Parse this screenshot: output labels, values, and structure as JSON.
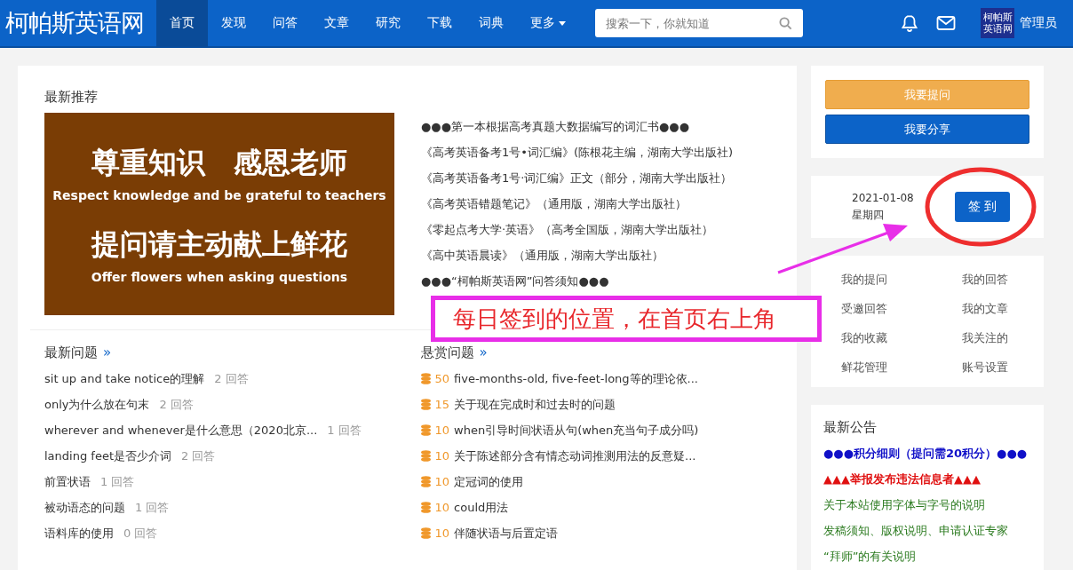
{
  "navbar": {
    "logo": "柯帕斯英语网",
    "items": [
      {
        "label": "首页",
        "selected": true
      },
      {
        "label": "发现",
        "selected": false
      },
      {
        "label": "问答",
        "selected": false
      },
      {
        "label": "文章",
        "selected": false
      },
      {
        "label": "研究",
        "selected": false
      },
      {
        "label": "下载",
        "selected": false
      },
      {
        "label": "词典",
        "selected": false
      },
      {
        "label": "更多",
        "selected": false,
        "dropdown": true
      }
    ],
    "search": {
      "placeholder": "搜索一下，你就知道"
    },
    "avatar_text": "柯帕斯英语网",
    "user": "管理员"
  },
  "recommend": {
    "title": "最新推荐",
    "banner": {
      "line1": "尊重知识　感恩老师",
      "line2": "Respect knowledge and be grateful to teachers",
      "line3": "提问请主动献上鲜花",
      "line4": "Offer flowers when asking questions"
    },
    "links": [
      "●●●第一本根据高考真题大数据编写的词汇书●●●",
      "《高考英语备考1号•词汇编》(陈根花主编，湖南大学出版社)",
      "《高考英语备考1号·词汇编》正文（部分，湖南大学出版社）",
      "《高考英语错题笔记》（通用版，湖南大学出版社）",
      "《零起点考大学·英语》（高考全国版，湖南大学出版社）",
      "《高中英语晨读》（通用版，湖南大学出版社）",
      "●●●“柯帕斯英语网”问答须知●●●"
    ]
  },
  "latest_questions": {
    "title": "最新问题",
    "more": "»",
    "items": [
      {
        "title": "sit up and take notice的理解",
        "answers": "2 回答"
      },
      {
        "title": "only为什么放在句末",
        "answers": "2 回答"
      },
      {
        "title": "wherever and whenever是什么意思（2020北京...",
        "answers": "1 回答"
      },
      {
        "title": "landing feet是否少介词",
        "answers": "2 回答"
      },
      {
        "title": "前置状语",
        "answers": "1 回答"
      },
      {
        "title": "被动语态的问题",
        "answers": "1 回答"
      },
      {
        "title": "语料库的使用",
        "answers": "0 回答"
      }
    ]
  },
  "bounty_questions": {
    "title": "悬赏问题",
    "more": "»",
    "items": [
      {
        "points": "50",
        "title": "five-months-old, five-feet-long等的理论依..."
      },
      {
        "points": "15",
        "title": "关于现在完成时和过去时的问题"
      },
      {
        "points": "10",
        "title": "when引导时间状语从句(when充当句子成分吗)"
      },
      {
        "points": "10",
        "title": "关于陈述部分含有情态动词推测用法的反意疑..."
      },
      {
        "points": "10",
        "title": "定冠词的使用"
      },
      {
        "points": "10",
        "title": "could用法"
      },
      {
        "points": "10",
        "title": "伴随状语与后置定语"
      }
    ]
  },
  "sidebar": {
    "buttons": [
      {
        "label": "我要提问",
        "kind": "warning"
      },
      {
        "label": "我要分享",
        "kind": "primary"
      }
    ],
    "checkin": {
      "date": "2021-01-08",
      "weekday": "星期四",
      "button": "签 到"
    },
    "links": [
      "我的提问",
      "我的回答",
      "受邀回答",
      "我的文章",
      "我的收藏",
      "我关注的",
      "鲜花管理",
      "账号设置"
    ],
    "notices": {
      "title": "最新公告",
      "items": [
        {
          "text": "●●●积分细则（提问需20积分）●●●",
          "color": "#1010c8",
          "bold": true
        },
        {
          "text": "▲▲▲举报发布违法信息者▲▲▲",
          "color": "#e01010",
          "bold": true
        },
        {
          "text": "关于本站使用字体与字号的说明",
          "color": "#2a7a1e",
          "bold": false
        },
        {
          "text": "发稿须知、版权说明、申请认证专家",
          "color": "#2a7a1e",
          "bold": false
        },
        {
          "text": "“拜师”的有关说明",
          "color": "#2a7a1e",
          "bold": false
        }
      ]
    }
  },
  "annotation": {
    "text": "每日签到的位置，在首页右上角"
  }
}
